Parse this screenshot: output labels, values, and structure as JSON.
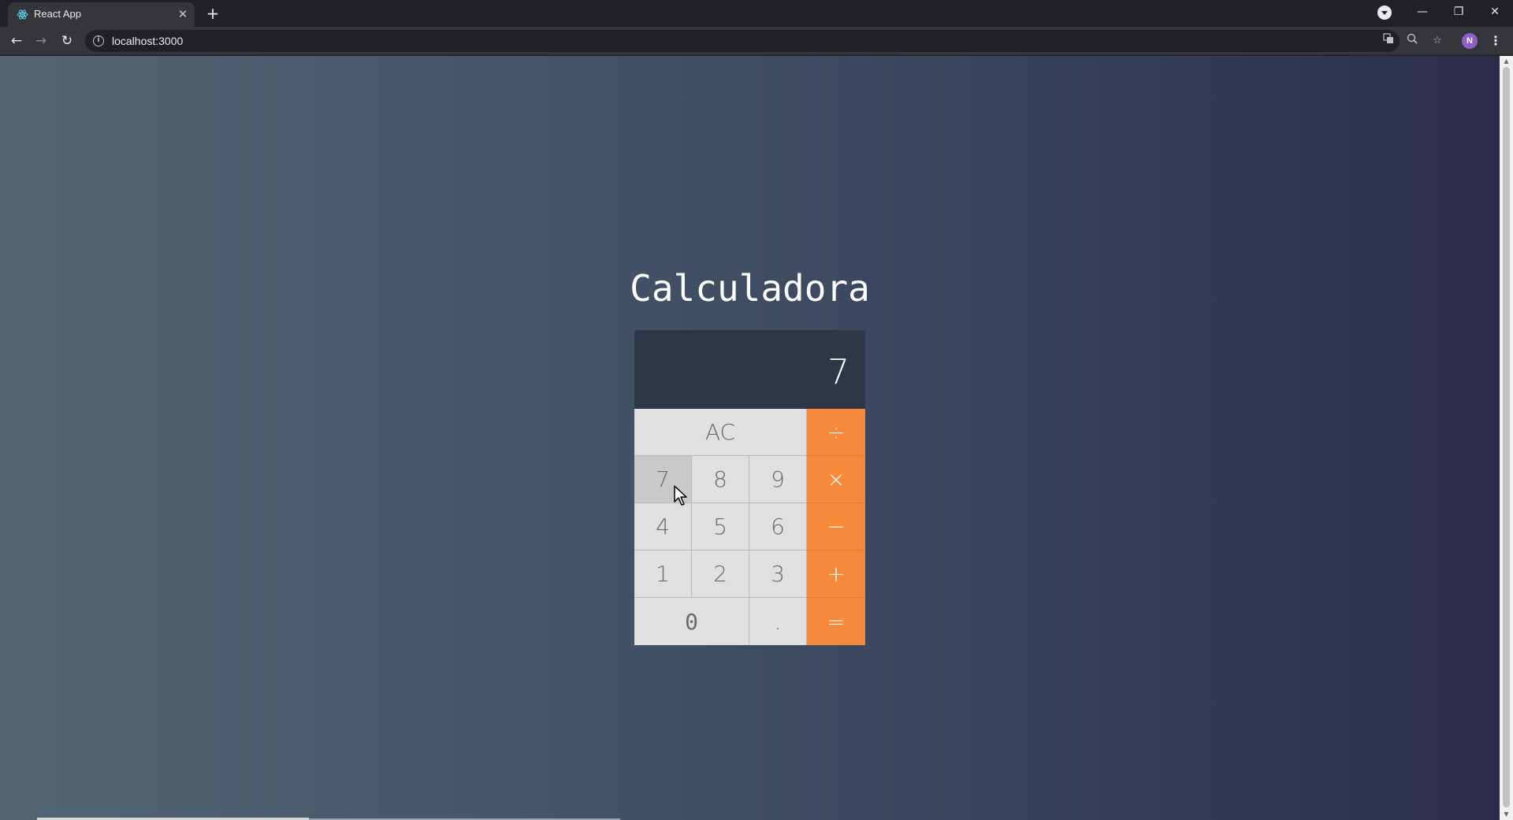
{
  "browser": {
    "tab_title": "React App",
    "tab_close": "✕",
    "new_tab": "+",
    "url": "localhost:3000",
    "back": "←",
    "forward": "→",
    "reload": "↻",
    "info": "i",
    "translate_icon": "translate-icon",
    "zoom_icon": "zoom-icon",
    "bookmark_icon": "star-icon",
    "profile_initial": "N",
    "menu": "⋮",
    "window": {
      "minimize": "—",
      "restore": "❐",
      "close": "✕"
    }
  },
  "page": {
    "title": "Calculadora"
  },
  "calculator": {
    "display_value": "7",
    "keys": {
      "ac": "AC",
      "divide": "÷",
      "multiply": "×",
      "subtract": "−",
      "add": "+",
      "equals": "=",
      "dot": ".",
      "n0": "0",
      "n1": "1",
      "n2": "2",
      "n3": "3",
      "n4": "4",
      "n5": "5",
      "n6": "6",
      "n7": "7",
      "n8": "8",
      "n9": "9"
    },
    "colors": {
      "operator": "#f6893a",
      "digit": "#e0e0e0",
      "display": "#2e3648"
    }
  }
}
